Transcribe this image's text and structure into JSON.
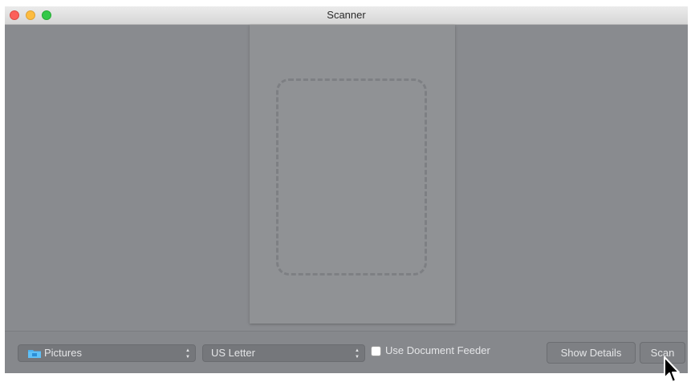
{
  "window": {
    "title": "Scanner"
  },
  "toolbar": {
    "destination": {
      "value": "Pictures",
      "icon": "folder-icon"
    },
    "paper_size": {
      "value": "US Letter"
    },
    "document_feeder": {
      "label": "Use Document Feeder",
      "checked": false
    },
    "show_details_label": "Show Details",
    "scan_label": "Scan"
  },
  "colors": {
    "background": "#898b8f",
    "accent_folder": "#4ab0f0"
  }
}
